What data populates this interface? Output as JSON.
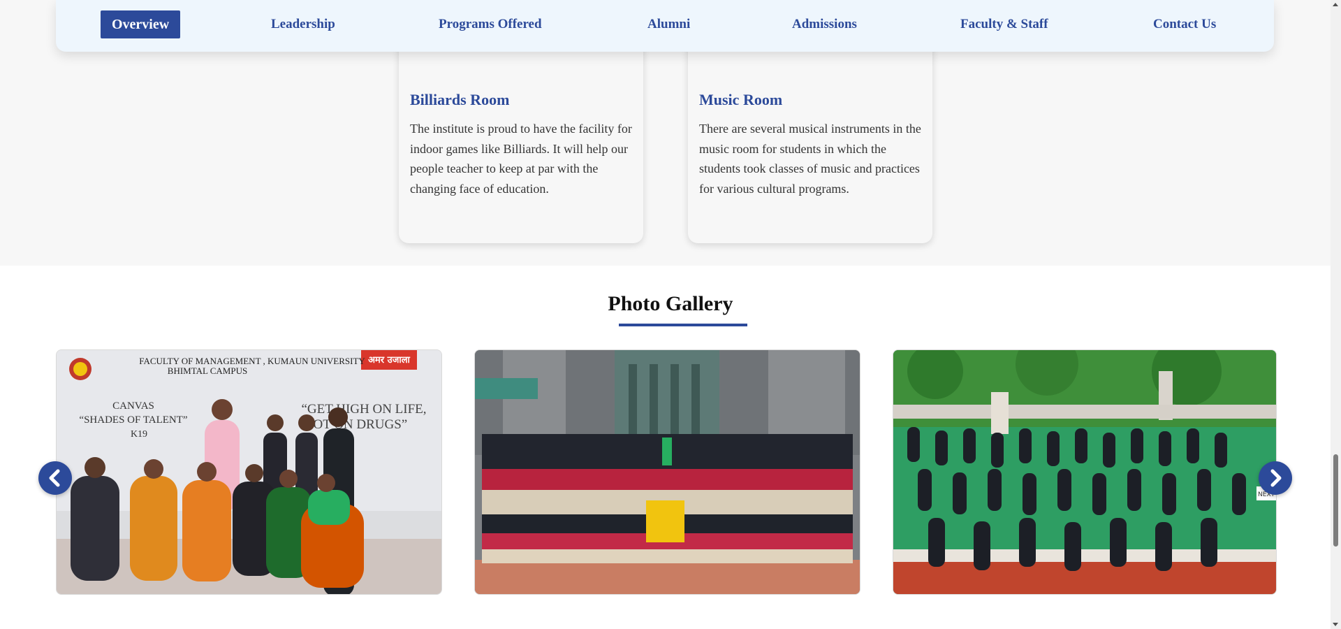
{
  "nav": {
    "tabs": [
      {
        "label": "Overview",
        "active": true
      },
      {
        "label": "Leadership"
      },
      {
        "label": "Programs Offered"
      },
      {
        "label": "Alumni"
      },
      {
        "label": "Admissions"
      },
      {
        "label": "Faculty & Staff"
      },
      {
        "label": "Contact Us"
      }
    ]
  },
  "facilities": [
    {
      "title": "Billiards Room",
      "description": "The institute is proud to have the facility for indoor games like Billiards. It will help our people teacher to keep at par with the changing face of education."
    },
    {
      "title": "Music Room",
      "description": "There are several musical instruments in the music room for students in which the students took classes of music and practices for various cultural programs."
    }
  ],
  "gallery": {
    "title": "Photo Gallery",
    "slides": [
      {
        "banner_line1": "FACULTY OF MANAGEMENT , KUMAUN UNIVERSITY",
        "banner_line2": "BHIMTAL CAMPUS",
        "banner_left": "CANVAS",
        "banner_left2": "“SHADES OF TALENT”",
        "banner_year": "K19",
        "banner_right": "“GET HIGH ON LIFE,",
        "banner_right2": "NOT ON DRUGS”",
        "banner_logo_text": "अमर उजाला"
      },
      {},
      {
        "corner_text": "NEXT"
      }
    ],
    "prev_icon": "chevron-left-icon",
    "next_icon": "chevron-right-icon"
  },
  "colors": {
    "accent": "#2c4a9a",
    "tabbar_bg": "#eef6fd",
    "section_bg": "#f7f7f7"
  }
}
